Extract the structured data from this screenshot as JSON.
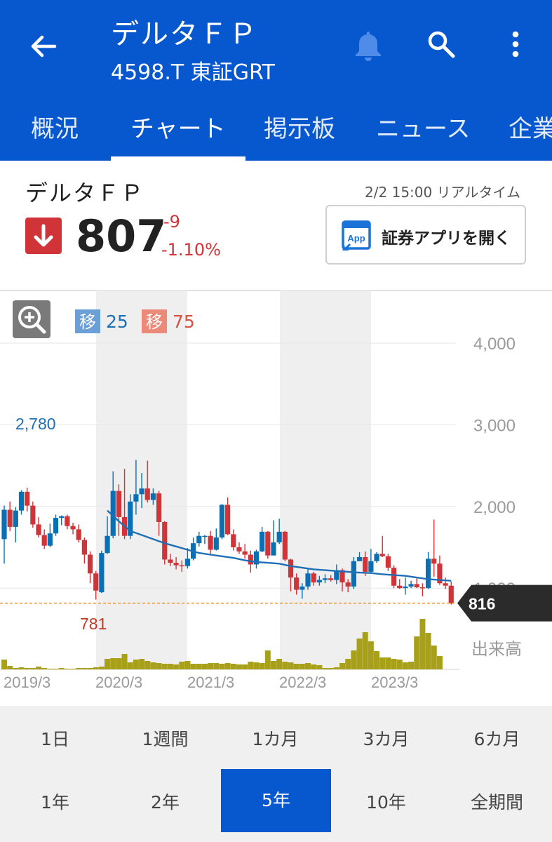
{
  "header": {
    "title": "デルタＦＰ",
    "subtitle": "4598.T 東証GRT"
  },
  "tabs": [
    "概況",
    "チャート",
    "掲示板",
    "ニュース",
    "企業"
  ],
  "stock": {
    "name": "デルタＦＰ",
    "timestamp": "2/2 15:00 リアルタイム",
    "price": "807",
    "change": "-9",
    "change_pct": "-1.10%",
    "app_button": "証券アプリを開く",
    "app_icon_text": "App"
  },
  "chart_legend": {
    "ma_badge": "移",
    "ma_short": "25",
    "ma_long": "75"
  },
  "colors": {
    "brand": "#0757cf",
    "down": "#d03438",
    "up": "#0a6fb3",
    "ma25": "#1f6fb6",
    "volume": "#a9a019",
    "ref_line": "#f19226"
  },
  "chart_data": {
    "type": "candlestick",
    "x_labels": [
      "2019/3",
      "2020/3",
      "2021/3",
      "2022/3",
      "2023/3"
    ],
    "y_ticks": [
      4000,
      3000,
      2000,
      1000
    ],
    "y_range": [
      500,
      4300
    ],
    "high_label": "2,780",
    "low_label": "781",
    "volume_label": "出来高",
    "current_price_tag": "816",
    "current_price": 816,
    "candles": [
      [
        1600,
        1960,
        1300,
        2010
      ],
      [
        1960,
        1750,
        1700,
        2060
      ],
      [
        1750,
        1950,
        1560,
        1990
      ],
      [
        1950,
        2180,
        1900,
        2200
      ],
      [
        2180,
        2010,
        1940,
        2230
      ],
      [
        2010,
        1780,
        1740,
        2060
      ],
      [
        1780,
        1650,
        1620,
        1870
      ],
      [
        1650,
        1520,
        1480,
        1720
      ],
      [
        1520,
        1670,
        1500,
        1790
      ],
      [
        1670,
        1860,
        1640,
        1900
      ],
      [
        1860,
        1880,
        1770,
        1890
      ],
      [
        1880,
        1760,
        1720,
        1900
      ],
      [
        1760,
        1720,
        1660,
        1800
      ],
      [
        1720,
        1590,
        1560,
        1780
      ],
      [
        1590,
        1410,
        1300,
        1620
      ],
      [
        1410,
        1180,
        1060,
        1450
      ],
      [
        1180,
        970,
        860,
        1210
      ],
      [
        950,
        1430,
        940,
        1460
      ],
      [
        1430,
        1640,
        1420,
        1880
      ],
      [
        1640,
        2190,
        1610,
        2430
      ],
      [
        2190,
        1870,
        1640,
        2270
      ],
      [
        1870,
        1640,
        1600,
        2460
      ],
      [
        1640,
        2060,
        1600,
        2150
      ],
      [
        2060,
        2150,
        1900,
        2570
      ],
      [
        2150,
        2220,
        1980,
        2410
      ],
      [
        2220,
        2080,
        2050,
        2560
      ],
      [
        2080,
        2160,
        2020,
        2220
      ],
      [
        2160,
        1810,
        1640,
        2190
      ],
      [
        1810,
        1350,
        1290,
        1820
      ],
      [
        1350,
        1310,
        1270,
        1420
      ],
      [
        1310,
        1280,
        1230,
        1380
      ],
      [
        1280,
        1270,
        1200,
        1340
      ],
      [
        1270,
        1360,
        1240,
        1490
      ],
      [
        1360,
        1550,
        1340,
        1620
      ],
      [
        1550,
        1640,
        1510,
        1690
      ],
      [
        1640,
        1640,
        1540,
        1650
      ],
      [
        1640,
        1470,
        1410,
        1700
      ],
      [
        1470,
        1620,
        1460,
        1730
      ],
      [
        1620,
        2020,
        1600,
        2030
      ],
      [
        2020,
        1660,
        1650,
        2110
      ],
      [
        1660,
        1500,
        1460,
        1720
      ],
      [
        1500,
        1450,
        1420,
        1560
      ],
      [
        1450,
        1410,
        1360,
        1540
      ],
      [
        1410,
        1290,
        1190,
        1460
      ],
      [
        1290,
        1450,
        1240,
        1470
      ],
      [
        1450,
        1690,
        1440,
        1750
      ],
      [
        1690,
        1400,
        1360,
        1700
      ],
      [
        1400,
        1560,
        1400,
        1830
      ],
      [
        1560,
        1690,
        1540,
        1850
      ],
      [
        1690,
        1350,
        1330,
        1700
      ],
      [
        1350,
        1130,
        960,
        1360
      ],
      [
        1130,
        980,
        920,
        1180
      ],
      [
        980,
        1020,
        870,
        1060
      ],
      [
        1020,
        1180,
        980,
        1230
      ],
      [
        1180,
        1070,
        1030,
        1200
      ],
      [
        1070,
        1100,
        1030,
        1150
      ],
      [
        1100,
        1120,
        1060,
        1170
      ],
      [
        1120,
        1100,
        1080,
        1160
      ],
      [
        1100,
        1220,
        1050,
        1290
      ],
      [
        1220,
        1070,
        960,
        1240
      ],
      [
        1070,
        1020,
        950,
        1110
      ],
      [
        1020,
        1330,
        990,
        1380
      ],
      [
        1330,
        1380,
        1330,
        1440
      ],
      [
        1380,
        1200,
        1150,
        1450
      ],
      [
        1200,
        1330,
        1180,
        1480
      ],
      [
        1330,
        1420,
        1310,
        1440
      ],
      [
        1420,
        1390,
        1380,
        1640
      ],
      [
        1390,
        1250,
        1210,
        1420
      ],
      [
        1250,
        1030,
        1000,
        1280
      ],
      [
        1030,
        1000,
        990,
        1110
      ],
      [
        1000,
        1020,
        920,
        1130
      ],
      [
        1020,
        1050,
        1000,
        1090
      ],
      [
        1050,
        1010,
        1000,
        1120
      ],
      [
        1010,
        1000,
        900,
        1060
      ],
      [
        1000,
        1360,
        990,
        1440
      ],
      [
        1360,
        1300,
        1140,
        1840
      ],
      [
        1300,
        1060,
        1040,
        1400
      ],
      [
        1060,
        1030,
        990,
        1130
      ],
      [
        1030,
        816,
        800,
        1080
      ]
    ],
    "ma25": [
      [
        18,
        1950
      ],
      [
        20,
        1820
      ],
      [
        22,
        1700
      ],
      [
        24,
        1650
      ],
      [
        26,
        1600
      ],
      [
        28,
        1550
      ],
      [
        30,
        1510
      ],
      [
        32,
        1470
      ],
      [
        34,
        1430
      ],
      [
        36,
        1410
      ],
      [
        38,
        1390
      ],
      [
        40,
        1370
      ],
      [
        42,
        1340
      ],
      [
        44,
        1320
      ],
      [
        46,
        1310
      ],
      [
        48,
        1300
      ],
      [
        50,
        1270
      ],
      [
        52,
        1250
      ],
      [
        54,
        1230
      ],
      [
        56,
        1220
      ],
      [
        58,
        1210
      ],
      [
        60,
        1200
      ],
      [
        62,
        1190
      ],
      [
        64,
        1185
      ],
      [
        66,
        1170
      ],
      [
        68,
        1160
      ],
      [
        70,
        1150
      ],
      [
        72,
        1130
      ],
      [
        74,
        1110
      ],
      [
        76,
        1100
      ],
      [
        78,
        1090
      ]
    ],
    "volume": [
      14,
      5,
      2,
      3,
      2,
      2,
      4,
      2,
      1,
      1,
      2,
      1,
      1,
      2,
      2,
      2,
      3,
      4,
      15,
      16,
      16,
      22,
      10,
      14,
      15,
      12,
      10,
      9,
      8,
      8,
      7,
      11,
      12,
      8,
      8,
      8,
      9,
      9,
      8,
      9,
      8,
      7,
      7,
      11,
      10,
      9,
      27,
      12,
      15,
      11,
      10,
      8,
      8,
      9,
      7,
      6,
      2,
      2,
      3,
      9,
      15,
      27,
      44,
      53,
      40,
      26,
      17,
      17,
      15,
      14,
      10,
      11,
      47,
      72,
      52,
      34,
      19
    ]
  },
  "periods_row1": [
    "1日",
    "1週間",
    "1カ月",
    "3カ月",
    "6カ月"
  ],
  "periods_row2": [
    "1年",
    "2年",
    "5年",
    "10年",
    "全期間"
  ],
  "selected_period": "5年"
}
